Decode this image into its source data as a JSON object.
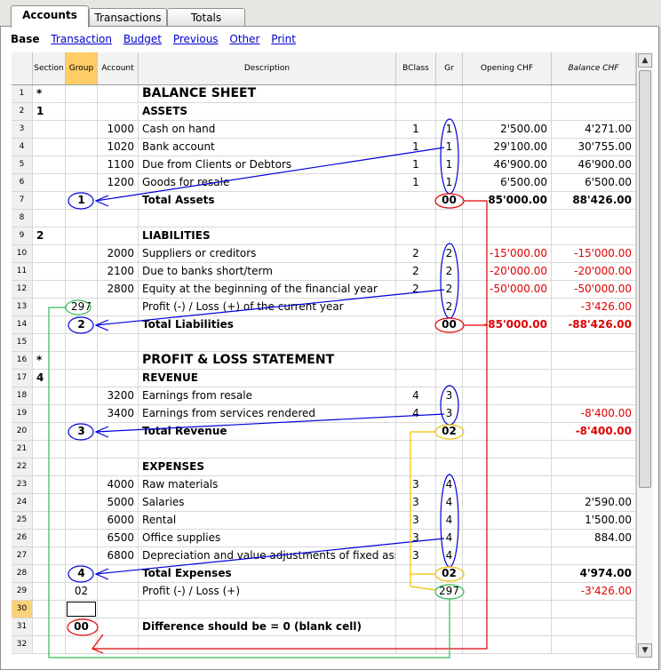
{
  "tabs": [
    "Accounts",
    "Transactions",
    "Totals"
  ],
  "views": {
    "current": "Base",
    "links": [
      "Transaction",
      "Budget",
      "Previous",
      "Other",
      "Print"
    ]
  },
  "columns": [
    "Section",
    "Group",
    "Account",
    "Description",
    "BClass",
    "Gr",
    "Opening CHF",
    "Balance CHF"
  ],
  "rows": [
    {
      "n": "1",
      "section": "*",
      "group": "",
      "account": "",
      "desc": "BALANCE SHEET",
      "bclass": "",
      "gr": "",
      "opening": "",
      "balance": "",
      "style": "big"
    },
    {
      "n": "2",
      "section": "1",
      "group": "",
      "account": "",
      "desc": "ASSETS",
      "bclass": "",
      "gr": "",
      "opening": "",
      "balance": "",
      "style": "b"
    },
    {
      "n": "3",
      "section": "",
      "group": "",
      "account": "1000",
      "desc": "Cash on hand",
      "bclass": "1",
      "gr": "1",
      "opening": "2'500.00",
      "balance": "4'271.00"
    },
    {
      "n": "4",
      "section": "",
      "group": "",
      "account": "1020",
      "desc": "Bank account",
      "bclass": "1",
      "gr": "1",
      "opening": "29'100.00",
      "balance": "30'755.00"
    },
    {
      "n": "5",
      "section": "",
      "group": "",
      "account": "1100",
      "desc": "Due from Clients or Debtors",
      "bclass": "1",
      "gr": "1",
      "opening": "46'900.00",
      "balance": "46'900.00"
    },
    {
      "n": "6",
      "section": "",
      "group": "",
      "account": "1200",
      "desc": "Goods for resale",
      "bclass": "1",
      "gr": "1",
      "opening": "6'500.00",
      "balance": "6'500.00"
    },
    {
      "n": "7",
      "section": "",
      "group": "1",
      "account": "",
      "desc": "Total Assets",
      "bclass": "",
      "gr": "00",
      "opening": "85'000.00",
      "balance": "88'426.00",
      "style": "b"
    },
    {
      "n": "8",
      "section": "",
      "group": "",
      "account": "",
      "desc": "",
      "bclass": "",
      "gr": "",
      "opening": "",
      "balance": ""
    },
    {
      "n": "9",
      "section": "2",
      "group": "",
      "account": "",
      "desc": "LIABILITIES",
      "bclass": "",
      "gr": "",
      "opening": "",
      "balance": "",
      "style": "b"
    },
    {
      "n": "10",
      "section": "",
      "group": "",
      "account": "2000",
      "desc": "Suppliers or creditors",
      "bclass": "2",
      "gr": "2",
      "opening": "-15'000.00",
      "balance": "-15'000.00",
      "neg": true
    },
    {
      "n": "11",
      "section": "",
      "group": "",
      "account": "2100",
      "desc": "Due to banks short/term",
      "bclass": "2",
      "gr": "2",
      "opening": "-20'000.00",
      "balance": "-20'000.00",
      "neg": true
    },
    {
      "n": "12",
      "section": "",
      "group": "",
      "account": "2800",
      "desc": "Equity at the beginning of the financial year",
      "bclass": "2",
      "gr": "2",
      "opening": "-50'000.00",
      "balance": "-50'000.00",
      "neg": true
    },
    {
      "n": "13",
      "section": "",
      "group": "297",
      "account": "",
      "desc": "Profit (-) / Loss (+) of the current year",
      "bclass": "",
      "gr": "2",
      "opening": "",
      "balance": "-3'426.00",
      "neg": true
    },
    {
      "n": "14",
      "section": "",
      "group": "2",
      "account": "",
      "desc": "Total Liabilities",
      "bclass": "",
      "gr": "00",
      "opening": "-85'000.00",
      "balance": "-88'426.00",
      "style": "b",
      "neg": true
    },
    {
      "n": "15",
      "section": "",
      "group": "",
      "account": "",
      "desc": "",
      "bclass": "",
      "gr": "",
      "opening": "",
      "balance": ""
    },
    {
      "n": "16",
      "section": "*",
      "group": "",
      "account": "",
      "desc": "PROFIT & LOSS STATEMENT",
      "bclass": "",
      "gr": "",
      "opening": "",
      "balance": "",
      "style": "big"
    },
    {
      "n": "17",
      "section": "4",
      "group": "",
      "account": "",
      "desc": "REVENUE",
      "bclass": "",
      "gr": "",
      "opening": "",
      "balance": "",
      "style": "b"
    },
    {
      "n": "18",
      "section": "",
      "group": "",
      "account": "3200",
      "desc": "Earnings from resale",
      "bclass": "4",
      "gr": "3",
      "opening": "",
      "balance": ""
    },
    {
      "n": "19",
      "section": "",
      "group": "",
      "account": "3400",
      "desc": "Earnings from services rendered",
      "bclass": "4",
      "gr": "3",
      "opening": "",
      "balance": "-8'400.00",
      "neg": true
    },
    {
      "n": "20",
      "section": "",
      "group": "3",
      "account": "",
      "desc": "Total Revenue",
      "bclass": "",
      "gr": "02",
      "opening": "",
      "balance": "-8'400.00",
      "style": "b",
      "neg": true
    },
    {
      "n": "21",
      "section": "",
      "group": "",
      "account": "",
      "desc": "",
      "bclass": "",
      "gr": "",
      "opening": "",
      "balance": ""
    },
    {
      "n": "22",
      "section": "",
      "group": "",
      "account": "",
      "desc": "EXPENSES",
      "bclass": "",
      "gr": "",
      "opening": "",
      "balance": "",
      "style": "b"
    },
    {
      "n": "23",
      "section": "",
      "group": "",
      "account": "4000",
      "desc": "Raw materials",
      "bclass": "3",
      "gr": "4",
      "opening": "",
      "balance": ""
    },
    {
      "n": "24",
      "section": "",
      "group": "",
      "account": "5000",
      "desc": "Salaries",
      "bclass": "3",
      "gr": "4",
      "opening": "",
      "balance": "2'590.00"
    },
    {
      "n": "25",
      "section": "",
      "group": "",
      "account": "6000",
      "desc": "Rental",
      "bclass": "3",
      "gr": "4",
      "opening": "",
      "balance": "1'500.00"
    },
    {
      "n": "26",
      "section": "",
      "group": "",
      "account": "6500",
      "desc": "Office supplies",
      "bclass": "3",
      "gr": "4",
      "opening": "",
      "balance": "884.00"
    },
    {
      "n": "27",
      "section": "",
      "group": "",
      "account": "6800",
      "desc": "Depreciation and value adjustments of fixed assets",
      "bclass": "3",
      "gr": "4",
      "opening": "",
      "balance": ""
    },
    {
      "n": "28",
      "section": "",
      "group": "4",
      "account": "",
      "desc": "Total Expenses",
      "bclass": "",
      "gr": "02",
      "opening": "",
      "balance": "4'974.00",
      "style": "b"
    },
    {
      "n": "29",
      "section": "",
      "group": "02",
      "account": "",
      "desc": "Profit (-) / Loss (+)",
      "bclass": "",
      "gr": "297",
      "opening": "",
      "balance": "-3'426.00",
      "neg": true
    },
    {
      "n": "30",
      "section": "",
      "group": "",
      "account": "",
      "desc": "",
      "bclass": "",
      "gr": "",
      "opening": "",
      "balance": "",
      "selected": true
    },
    {
      "n": "31",
      "section": "",
      "group": "00",
      "account": "",
      "desc": "Difference should be = 0 (blank cell)",
      "bclass": "",
      "gr": "",
      "opening": "",
      "balance": "",
      "style": "b"
    },
    {
      "n": "32",
      "section": "",
      "group": "",
      "account": "",
      "desc": "",
      "bclass": "",
      "gr": "",
      "opening": "",
      "balance": ""
    }
  ],
  "annotation_colors": {
    "blue": "#0000dd",
    "red": "#e00000",
    "yellow": "#f0c000",
    "green": "#33bb55"
  }
}
